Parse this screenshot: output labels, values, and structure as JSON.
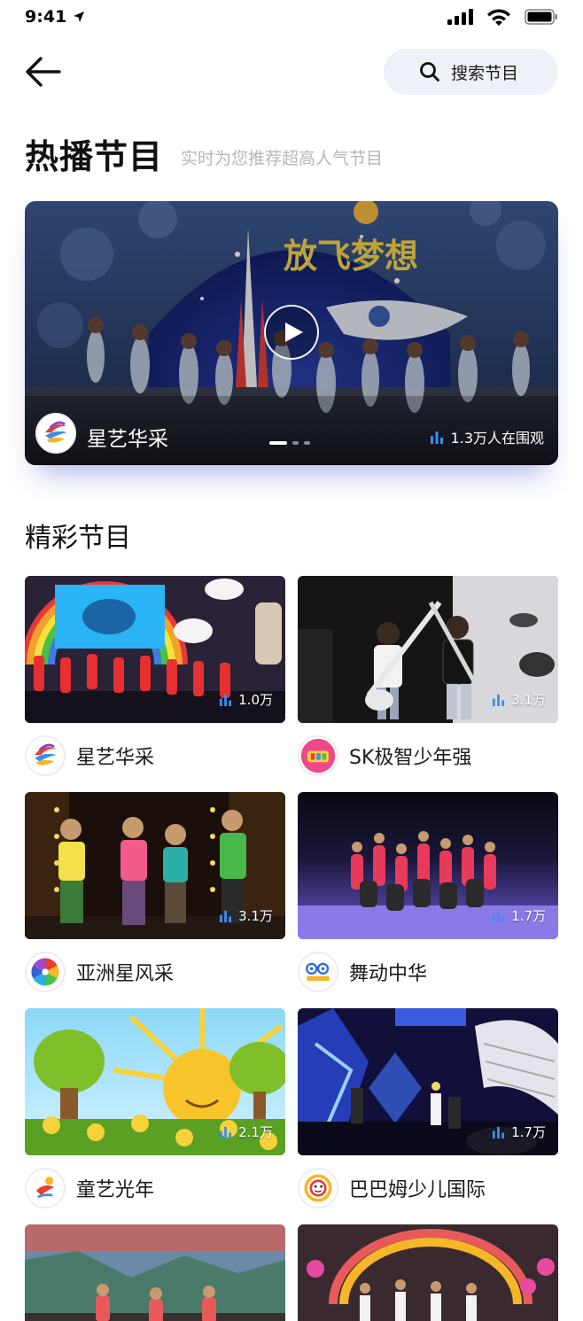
{
  "status_bar": {
    "time": "9:41"
  },
  "header": {
    "search_label": "搜索节目"
  },
  "hot": {
    "title": "热播节目",
    "subtitle": "实时为您推荐超高人气节目",
    "banner": {
      "name": "星艺华采",
      "viewers": "1.3万人在围观",
      "banner_text": "放飞梦想",
      "dots": 3,
      "active_dot": 0
    }
  },
  "featured": {
    "title": "精彩节目",
    "cards": [
      {
        "name": "星艺华采",
        "count": "1.0万"
      },
      {
        "name": "SK极智少年强",
        "count": "3.1万"
      },
      {
        "name": "亚洲星风采",
        "count": "3.1万"
      },
      {
        "name": "舞动中华",
        "count": "1.7万"
      },
      {
        "name": "童艺光年",
        "count": "2.1万"
      },
      {
        "name": "巴巴姆少儿国际",
        "count": "1.7万"
      }
    ]
  },
  "colors": {
    "accent": "#3a8ff0",
    "search_bg": "#eef1f7",
    "subtitle": "#b4b6bc"
  }
}
